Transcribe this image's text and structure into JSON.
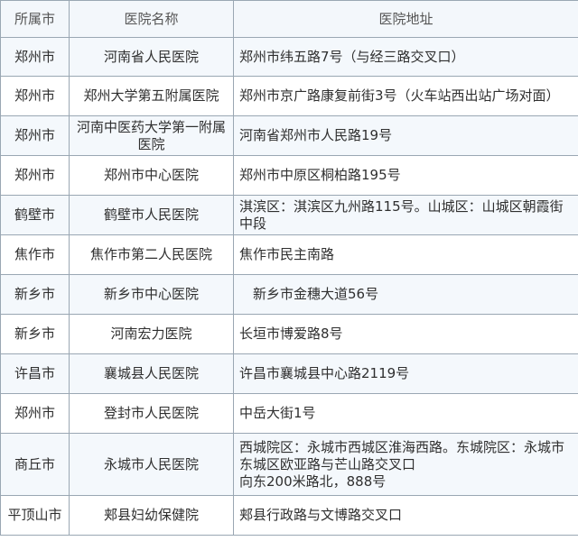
{
  "table": {
    "headers": [
      "所属市",
      "医院名称",
      "医院地址"
    ],
    "rows": [
      {
        "city": "郑州市",
        "hospital": "河南省人民医院",
        "address": "郑州市纬五路7号（与经三路交叉口）"
      },
      {
        "city": "郑州市",
        "hospital": "郑州大学第五附属医院",
        "address": "郑州市京广路康复前街3号（火车站西出站广场对面）"
      },
      {
        "city": "郑州市",
        "hospital": "河南中医药大学第一附属医院",
        "address": "河南省郑州市人民路19号"
      },
      {
        "city": "郑州市",
        "hospital": "郑州市中心医院",
        "address": "郑州市中原区桐柏路195号"
      },
      {
        "city": "鹤壁市",
        "hospital": "鹤壁市人民医院",
        "address": "淇滨区：淇滨区九州路115号。山城区：山城区朝霞街中段"
      },
      {
        "city": "焦作市",
        "hospital": "焦作市第二人民医院",
        "address": "焦作市民主南路"
      },
      {
        "city": "新乡市",
        "hospital": "新乡市中心医院",
        "address": "　新乡市金穗大道56号"
      },
      {
        "city": "新乡市",
        "hospital": "河南宏力医院",
        "address": "长垣市博爱路8号"
      },
      {
        "city": "许昌市",
        "hospital": "襄城县人民医院",
        "address": "许昌市襄城县中心路2119号"
      },
      {
        "city": "郑州市",
        "hospital": "登封市人民医院",
        "address": "中岳大街1号"
      },
      {
        "city": "商丘市",
        "hospital": "永城市人民医院",
        "address": "西城院区：永城市西城区淮海西路。东城院区：永城市东城区欧亚路与芒山路交叉口\n向东200米路北，888号"
      },
      {
        "city": "平顶山市",
        "hospital": "郏县妇幼保健院",
        "address": "郏县行政路与文博路交叉口"
      }
    ]
  }
}
